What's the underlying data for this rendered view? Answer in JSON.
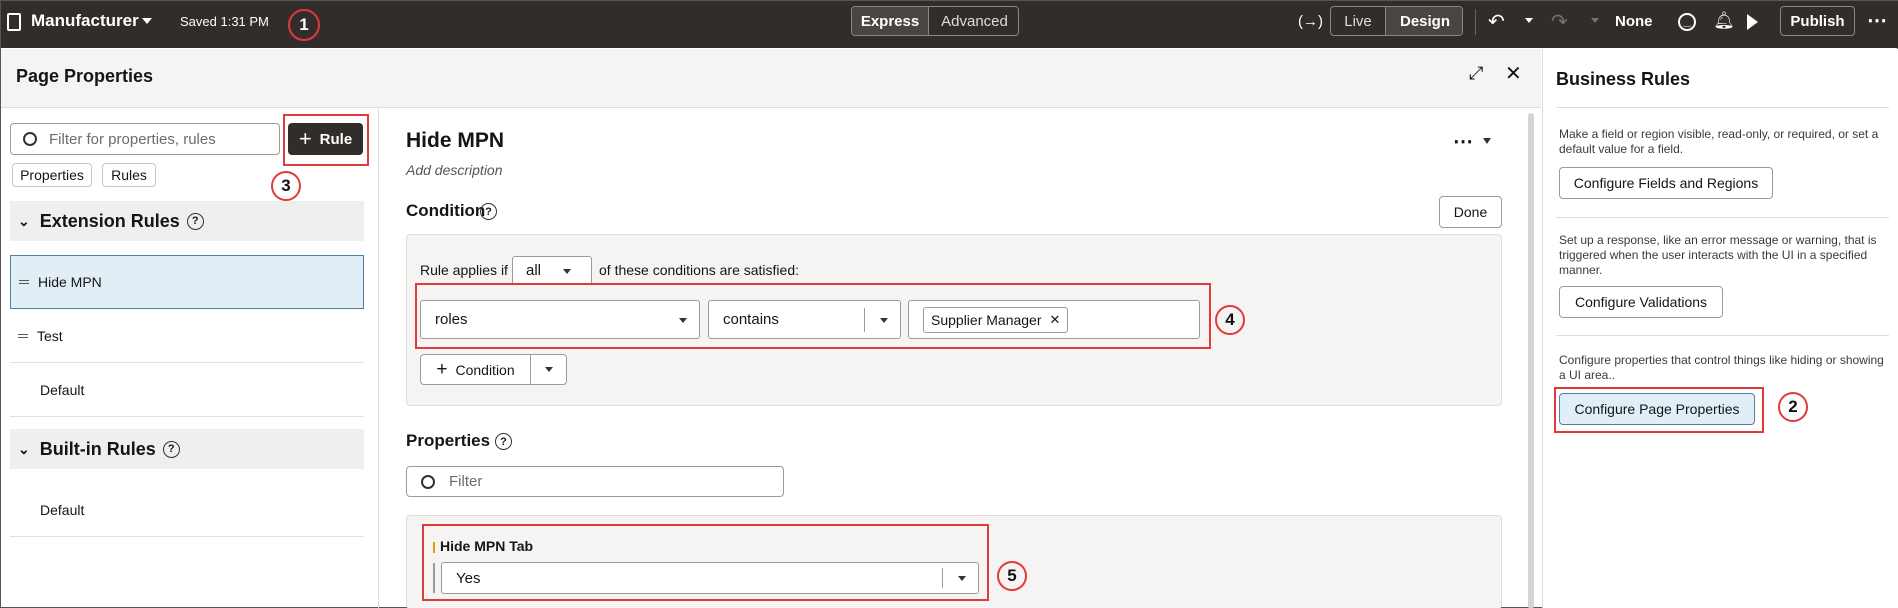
{
  "topbar": {
    "app_title": "Manufacturer",
    "saved_status": "Saved 1:31 PM",
    "mode_express": "Express",
    "mode_advanced": "Advanced",
    "view_live": "Live",
    "view_design": "Design",
    "none_label": "None",
    "publish_label": "Publish",
    "code_symbol": "(→)"
  },
  "callouts": {
    "c1": "1",
    "c2": "2",
    "c3": "3",
    "c4": "4",
    "c5": "5"
  },
  "page_properties": {
    "title": "Page Properties",
    "filter_placeholder": "Filter for properties, rules",
    "rule_button": "Rule",
    "tabs": [
      "Properties",
      "Rules"
    ],
    "extension_rules_title": "Extension Rules",
    "extension_rules": [
      "Hide MPN",
      "Test",
      "Default"
    ],
    "builtin_rules_title": "Built-in Rules",
    "builtin_rules": [
      "Default"
    ]
  },
  "rule_editor": {
    "title": "Hide MPN",
    "description_placeholder": "Add description",
    "condition_title": "Condition",
    "done_label": "Done",
    "rule_applies_prefix": "Rule applies if",
    "match_value": "all",
    "rule_applies_suffix": "of these conditions are satisfied:",
    "condition_field": "roles",
    "condition_operator": "contains",
    "condition_value_chip": "Supplier Manager",
    "add_condition_label": "Condition",
    "properties_title": "Properties",
    "properties_filter_placeholder": "Filter",
    "property_label": "Hide MPN Tab",
    "property_value": "Yes"
  },
  "business_rules": {
    "title": "Business Rules",
    "desc1": "Make a field or region visible, read-only, or required, or set a default value for a field.",
    "btn1": "Configure Fields and Regions",
    "desc2": "Set up a response, like an error message or warning, that is triggered when the user interacts with the UI in a specified manner.",
    "btn2": "Configure Validations",
    "desc3": "Configure properties that control things like hiding or showing a UI area..",
    "btn3": "Configure Page Properties"
  }
}
